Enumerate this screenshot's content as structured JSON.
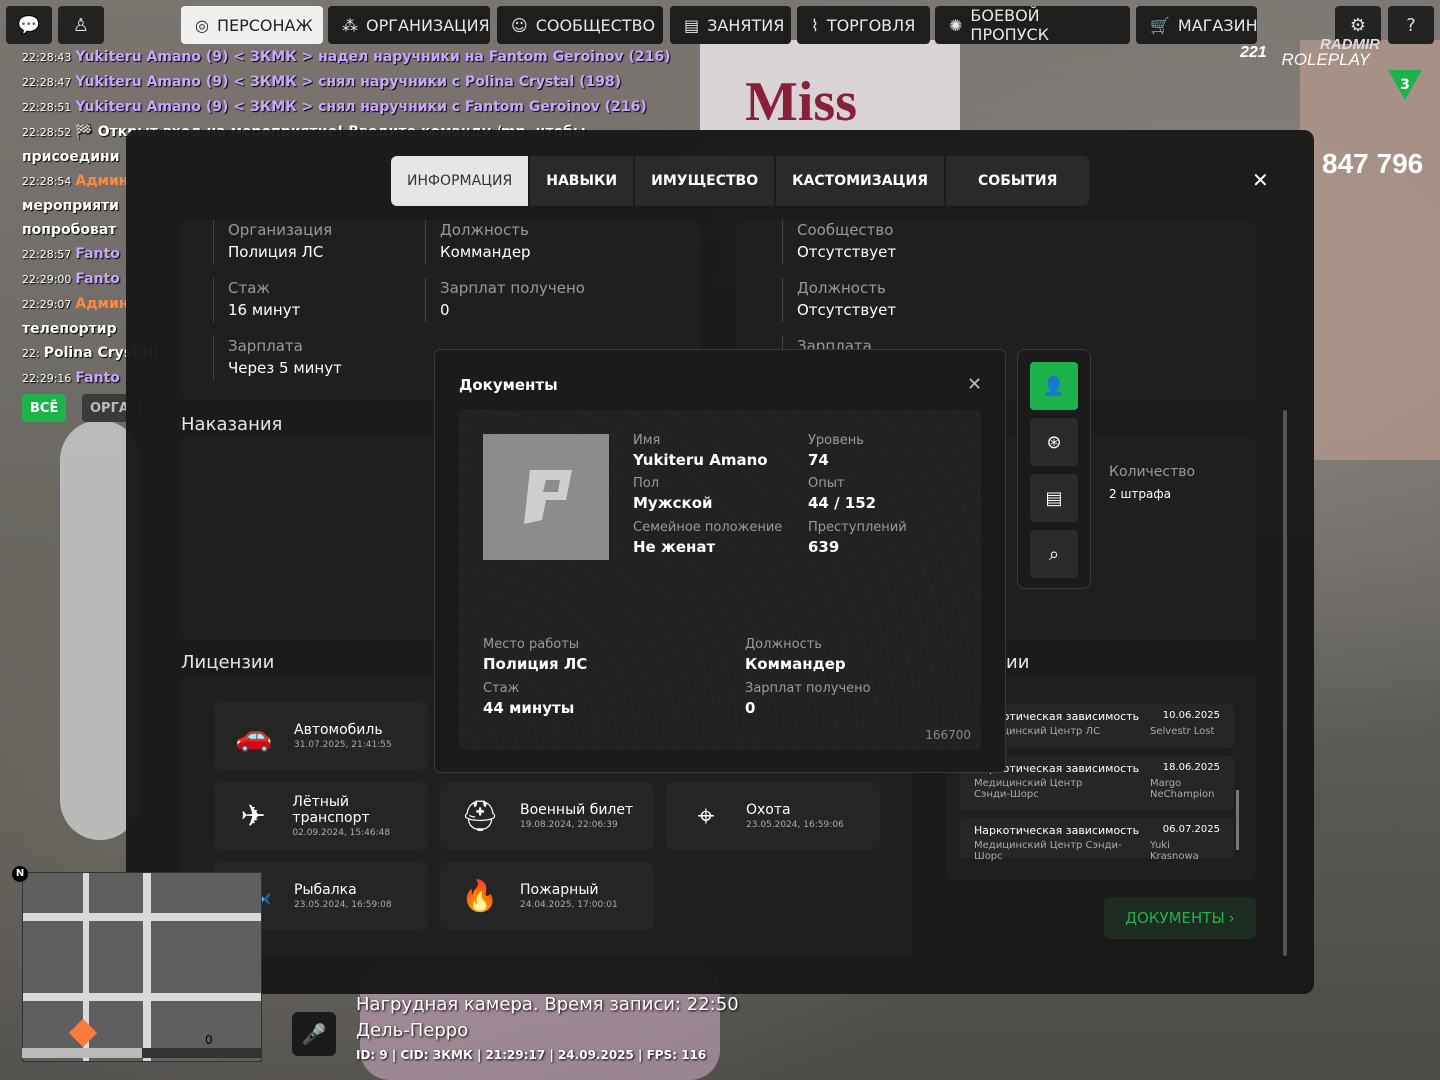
{
  "topbar": {
    "tabs": [
      {
        "label": "ПЕРСОНАЖ",
        "icon": "person-icon",
        "active": true
      },
      {
        "label": "ОРГАНИЗАЦИЯ",
        "icon": "org-icon"
      },
      {
        "label": "СООБЩЕСТВО",
        "icon": "community-icon"
      },
      {
        "label": "ЗАНЯТИЯ",
        "icon": "tasks-icon"
      },
      {
        "label": "ТОРГОВЛЯ",
        "icon": "chart-icon"
      },
      {
        "label": "БОЕВОЙ ПРОПУСК",
        "icon": "battlepass-icon"
      },
      {
        "label": "МАГАЗИН",
        "icon": "cart-icon"
      }
    ]
  },
  "chat": {
    "lines": [
      {
        "time": "22:28:43",
        "text": "Yukiteru Amano (9) < ЗКМК > надел наручники на Fantom Geroinov (216)"
      },
      {
        "time": "22:28:47",
        "text": "Yukiteru Amano (9) < ЗКМК > снял наручники с Polina Crystal (198)"
      },
      {
        "time": "22:28:51",
        "text": "Yukiteru Amano (9) < ЗКМК > снял наручники с Fantom Geroinov (216)"
      },
      {
        "time": "22:28:52",
        "text": "🏁 Открыт вход на мероприятие! Введите команду /mp, чтобы"
      },
      {
        "time": "",
        "text": "присоедини"
      },
      {
        "time": "22:28:54",
        "text": "Админ"
      },
      {
        "time": "",
        "text": "мероприяти"
      },
      {
        "time": "",
        "text": "попробоват"
      },
      {
        "time": "22:28:57",
        "text": "Fanto"
      },
      {
        "time": "22:29:00",
        "text": "Fanto"
      },
      {
        "time": "22:29:07",
        "text": "Админ"
      },
      {
        "time": "",
        "text": "телепортир"
      },
      {
        "time": "22:",
        "text": "Polina Crystal"
      },
      {
        "time": "22:29:16",
        "text": "Fanto"
      }
    ],
    "filter_all": "ВСЁ",
    "filter_org": "ОРГА"
  },
  "hud": {
    "level": "221",
    "brand_top": "RADMIR",
    "brand_bottom": "ROLEPLAY",
    "badge": "3",
    "money": "847 796",
    "bg_sign": "Miss"
  },
  "panel": {
    "tabs": [
      "ИНФОРМАЦИЯ",
      "НАВЫКИ",
      "ИМУЩЕСТВО",
      "КАСТОМИЗАЦИЯ",
      "СОБЫТИЯ"
    ],
    "close": "✕",
    "org": {
      "organization_label": "Организация",
      "organization": "Полиция ЛС",
      "position_label": "Должность",
      "position": "Коммандер",
      "tenure_label": "Стаж",
      "tenure": "16 минут",
      "salaries_label": "Зарплат получено",
      "salaries": "0",
      "salary_label": "Зарплата",
      "salary": "Через 5 минут"
    },
    "community": {
      "community_label": "Сообщество",
      "community": "Отсутствует",
      "position_label": "Должность",
      "position": "Отсутствует",
      "salary_label": "Зарплата"
    },
    "punishments_title": "Наказания",
    "fines": {
      "count_label": "Количество",
      "count": "2 штрафа"
    },
    "licenses_title": "Лицензии",
    "licenses": [
      {
        "name": "Автомобиль",
        "date": "31.07.2025, 21:41:55",
        "icon": "car-icon"
      },
      {
        "name": "Лётный транспорт",
        "date": "02.09.2024, 15:46:48",
        "icon": "plane-icon"
      },
      {
        "name": "Военный билет",
        "date": "19.08.2024, 22:06:39",
        "icon": "helmet-icon"
      },
      {
        "name": "Охота",
        "date": "23.05.2024, 16:59:06",
        "icon": "crosshair-icon"
      },
      {
        "name": "Рыбалка",
        "date": "23.05.2024, 16:59:08",
        "icon": "fish-icon"
      },
      {
        "name": "Пожарный",
        "date": "24.04.2025, 17:00:01",
        "icon": "fire-icon"
      }
    ],
    "history_title_fragment": "ии",
    "history": [
      {
        "title": "Наркотическая зависимость",
        "date": "10.06.2025",
        "place": "Медицинский Центр ЛС",
        "name": "Selvestr Lost"
      },
      {
        "title": "Наркотическая зависимость",
        "date": "18.06.2025",
        "place": "Медицинский Центр Сэнди-Шорс",
        "name": "Margo NeChampion"
      },
      {
        "title": "Наркотическая зависимость",
        "date": "06.07.2025",
        "place": "Медицинский Центр Сэнди-Шорс",
        "name": "Yuki Krasnowa"
      }
    ],
    "docs_button": "ДОКУМЕНТЫ"
  },
  "documents": {
    "title": "Документы",
    "name_label": "Имя",
    "name": "Yukiteru Amano",
    "level_label": "Уровень",
    "level": "74",
    "sex_label": "Пол",
    "sex": "Мужской",
    "exp_label": "Опыт",
    "exp": "44 / 152",
    "marital_label": "Семейное положение",
    "marital": "Не женат",
    "crimes_label": "Преступлений",
    "crimes": "639",
    "work_label": "Место работы",
    "work": "Полиция ЛС",
    "position_label": "Должность",
    "position": "Коммандер",
    "tenure_label": "Стаж",
    "tenure": "44 минуты",
    "salaries_label": "Зарплат получено",
    "salaries": "0",
    "number": "166700"
  },
  "status": {
    "camera": "Нагрудная камера. Время записи: 22:50",
    "location": "Дель-Перро",
    "info": "ID: 9 | CID: ЗКМК | 21:29:17   | 24.09.2025 | FPS: 116"
  },
  "minimap": {
    "north": "N",
    "zero": "0"
  }
}
